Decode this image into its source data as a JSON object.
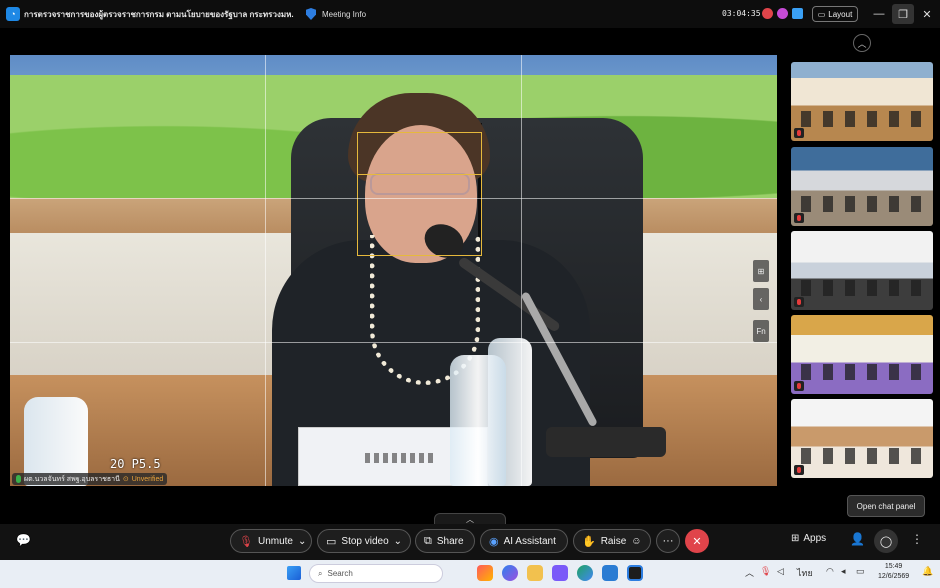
{
  "titlebar": {
    "app_logo": "webex-logo",
    "meeting_title": "การตรวจราชการของผู้ตรวจราชการกรม ตามนโยบายของรัฐบาล กระทรวงมห...",
    "meeting_info_icon": "shield-icon",
    "meeting_info_label": "Meeting Info",
    "elapsed_time": "03:04:35",
    "layout_label": "Layout",
    "colors": {
      "background": "#0d0d0d",
      "record_red": "#e0444a"
    }
  },
  "stage": {
    "participant_name": "ผต.นวลจันทร์ สพฐ.อุบลราชธานี",
    "verification": "Unverified",
    "overlay_stamp": "20  P5.5",
    "nameplate_text": "ILA ●●●●S",
    "side_tools": [
      "⊞",
      "‹",
      "Fn"
    ]
  },
  "thumbnails": [
    "conference-room-1",
    "conference-room-2",
    "conference-room-3",
    "conference-room-4",
    "conference-room-5"
  ],
  "controls": {
    "unmute_label": "Unmute",
    "stop_video_label": "Stop video",
    "share_label": "Share",
    "ai_assistant_label": "AI Assistant",
    "raise_label": "Raise",
    "more_label": "···",
    "end_label": "✕",
    "apps_label": "Apps",
    "chat_tooltip": "Open chat panel",
    "overflow_label": "⋮",
    "colors": {
      "end_call": "#e0444a",
      "accent": "#2d7de0"
    }
  },
  "taskbar": {
    "search_placeholder": "Search",
    "time": "15:49",
    "date": "12/6/2569",
    "language": "ไทย"
  }
}
